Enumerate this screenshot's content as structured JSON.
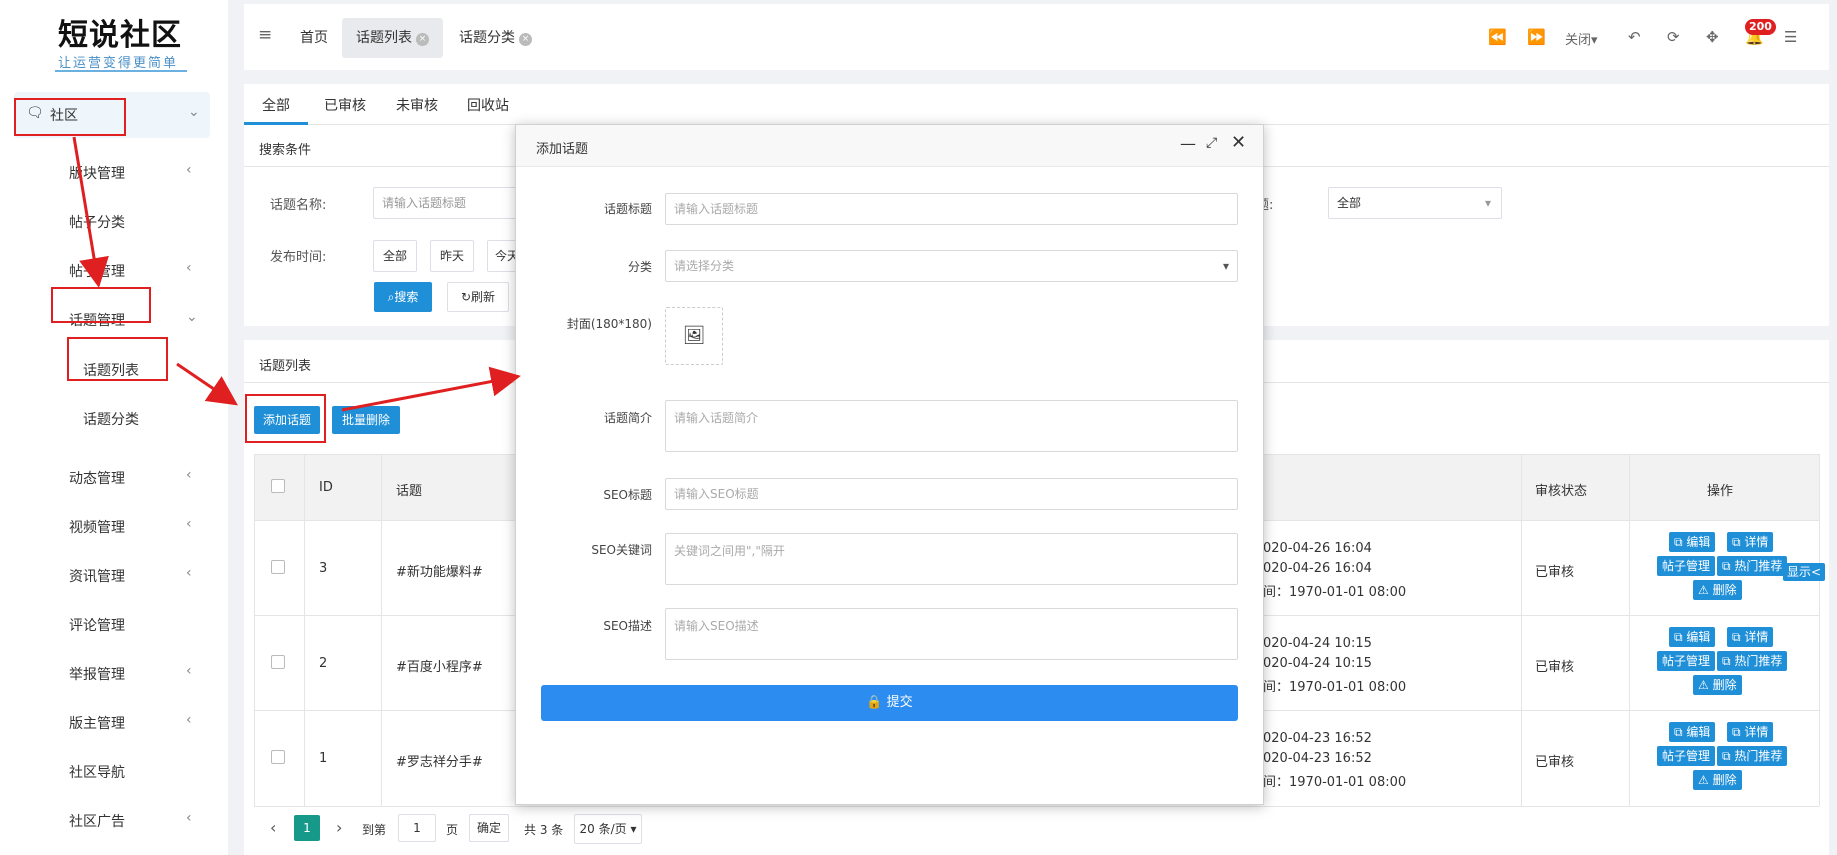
{
  "logo": {
    "title": "短说社区",
    "subtitle": "让运营变得更简单"
  },
  "sidebar": {
    "items": [
      {
        "label": "社区",
        "chevron": "⌄"
      },
      {
        "label": "版块管理",
        "chevron": "‹"
      },
      {
        "label": "帖子分类",
        "chevron": ""
      },
      {
        "label": "帖子管理",
        "chevron": "‹"
      },
      {
        "label": "话题管理",
        "chevron": "⌄"
      },
      {
        "label": "话题列表",
        "chevron": ""
      },
      {
        "label": "话题分类",
        "chevron": ""
      },
      {
        "label": "动态管理",
        "chevron": "‹"
      },
      {
        "label": "视频管理",
        "chevron": "‹"
      },
      {
        "label": "资讯管理",
        "chevron": "‹"
      },
      {
        "label": "评论管理",
        "chevron": ""
      },
      {
        "label": "举报管理",
        "chevron": "‹"
      },
      {
        "label": "版主管理",
        "chevron": "‹"
      },
      {
        "label": "社区导航",
        "chevron": ""
      },
      {
        "label": "社区广告",
        "chevron": "‹"
      }
    ]
  },
  "topbar": {
    "menu_icon": "≡",
    "tabs": [
      {
        "label": "首页"
      },
      {
        "label": "话题列表"
      },
      {
        "label": "话题分类"
      }
    ],
    "close_label": "关闭",
    "badge": "200"
  },
  "subtabs": [
    "全部",
    "已审核",
    "未审核",
    "回收站"
  ],
  "search": {
    "title": "搜索条件",
    "name_label": "话题名称:",
    "name_placeholder": "请输入话题标题",
    "status_label_tail": "题:",
    "status_value": "全部",
    "time_label": "发布时间:",
    "time_buttons": [
      "全部",
      "昨天",
      "今天"
    ],
    "search_btn": "搜索",
    "refresh_btn": "刷新"
  },
  "list": {
    "title": "话题列表",
    "add_btn": "添加话题",
    "batch_delete_btn": "批量删除",
    "headers": {
      "id": "ID",
      "topic": "话题",
      "status": "审核状态",
      "ops": "操作"
    },
    "rows": [
      {
        "id": "3",
        "topic": "#新功能爆料#",
        "t1": "020-04-26 16:04",
        "t2": "020-04-26 16:04",
        "t3": "间：1970-01-01 08:00",
        "status": "已审核"
      },
      {
        "id": "2",
        "topic": "#百度小程序#",
        "t1": "020-04-24 10:15",
        "t2": "020-04-24 10:15",
        "t3": "间：1970-01-01 08:00",
        "status": "已审核"
      },
      {
        "id": "1",
        "topic": "#罗志祥分手#",
        "t1": "020-04-23 16:52",
        "t2": "020-04-23 16:52",
        "t3": "间：1970-01-01 08:00",
        "status": "已审核"
      }
    ],
    "ops": {
      "edit": "编辑",
      "detail": "详情",
      "post_manage": "帖子管理",
      "hot": "热门推荐",
      "delete": "删除"
    },
    "side_tab": "显示<"
  },
  "pagination": {
    "current": "1",
    "goto_label": "到第",
    "goto_value": "1",
    "page_unit": "页",
    "confirm": "确定",
    "total": "共 3 条",
    "per_page": "20 条/页"
  },
  "modal": {
    "title": "添加话题",
    "title_label": "话题标题",
    "title_placeholder": "请输入话题标题",
    "category_label": "分类",
    "category_placeholder": "请选择分类",
    "cover_label": "封面(180*180)",
    "intro_label": "话题简介",
    "intro_placeholder": "请输入话题简介",
    "seo_title_label": "SEO标题",
    "seo_title_placeholder": "请输入SEO标题",
    "seo_kw_label": "SEO关键词",
    "seo_kw_placeholder": "关键词之间用\",\"隔开",
    "seo_desc_label": "SEO描述",
    "seo_desc_placeholder": "请输入SEO描述",
    "submit": "提交"
  },
  "colors": {
    "accent": "#1f8fd8",
    "annotation": "#e02020",
    "page_current": "#17998a"
  }
}
